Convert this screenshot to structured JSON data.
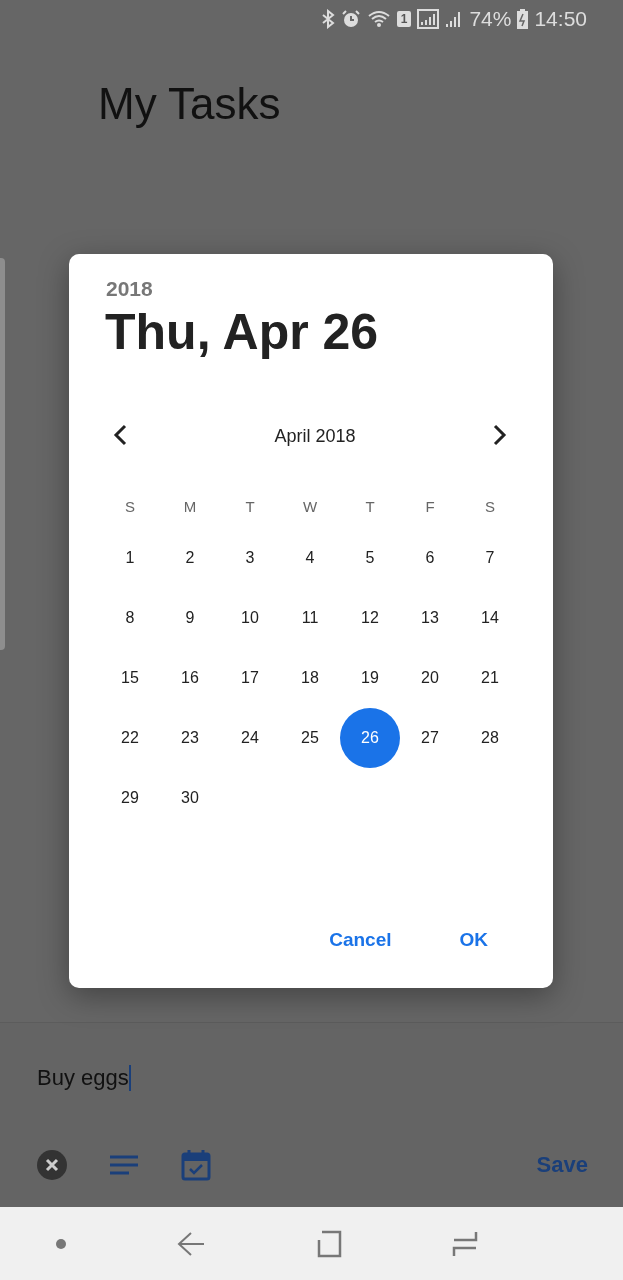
{
  "status_bar": {
    "sim_label": "1",
    "battery": "74%",
    "time": "14:50"
  },
  "app_title": "My Tasks",
  "dialog": {
    "year": "2018",
    "date": "Thu, Apr 26",
    "month": "April 2018",
    "weekdays": [
      "S",
      "M",
      "T",
      "W",
      "T",
      "F",
      "S"
    ],
    "days": [
      {
        "label": "1",
        "selected": false
      },
      {
        "label": "2",
        "selected": false
      },
      {
        "label": "3",
        "selected": false
      },
      {
        "label": "4",
        "selected": false
      },
      {
        "label": "5",
        "selected": false
      },
      {
        "label": "6",
        "selected": false
      },
      {
        "label": "7",
        "selected": false
      },
      {
        "label": "8",
        "selected": false
      },
      {
        "label": "9",
        "selected": false
      },
      {
        "label": "10",
        "selected": false
      },
      {
        "label": "11",
        "selected": false
      },
      {
        "label": "12",
        "selected": false
      },
      {
        "label": "13",
        "selected": false
      },
      {
        "label": "14",
        "selected": false
      },
      {
        "label": "15",
        "selected": false
      },
      {
        "label": "16",
        "selected": false
      },
      {
        "label": "17",
        "selected": false
      },
      {
        "label": "18",
        "selected": false
      },
      {
        "label": "19",
        "selected": false
      },
      {
        "label": "20",
        "selected": false
      },
      {
        "label": "21",
        "selected": false
      },
      {
        "label": "22",
        "selected": false
      },
      {
        "label": "23",
        "selected": false
      },
      {
        "label": "24",
        "selected": false
      },
      {
        "label": "25",
        "selected": false
      },
      {
        "label": "26",
        "selected": true
      },
      {
        "label": "27",
        "selected": false
      },
      {
        "label": "28",
        "selected": false
      },
      {
        "label": "29",
        "selected": false
      },
      {
        "label": "30",
        "selected": false
      }
    ],
    "buttons": [
      "Cancel",
      "OK"
    ]
  },
  "task": {
    "value": "Buy eggs"
  },
  "toolbar": {
    "save": "Save"
  }
}
